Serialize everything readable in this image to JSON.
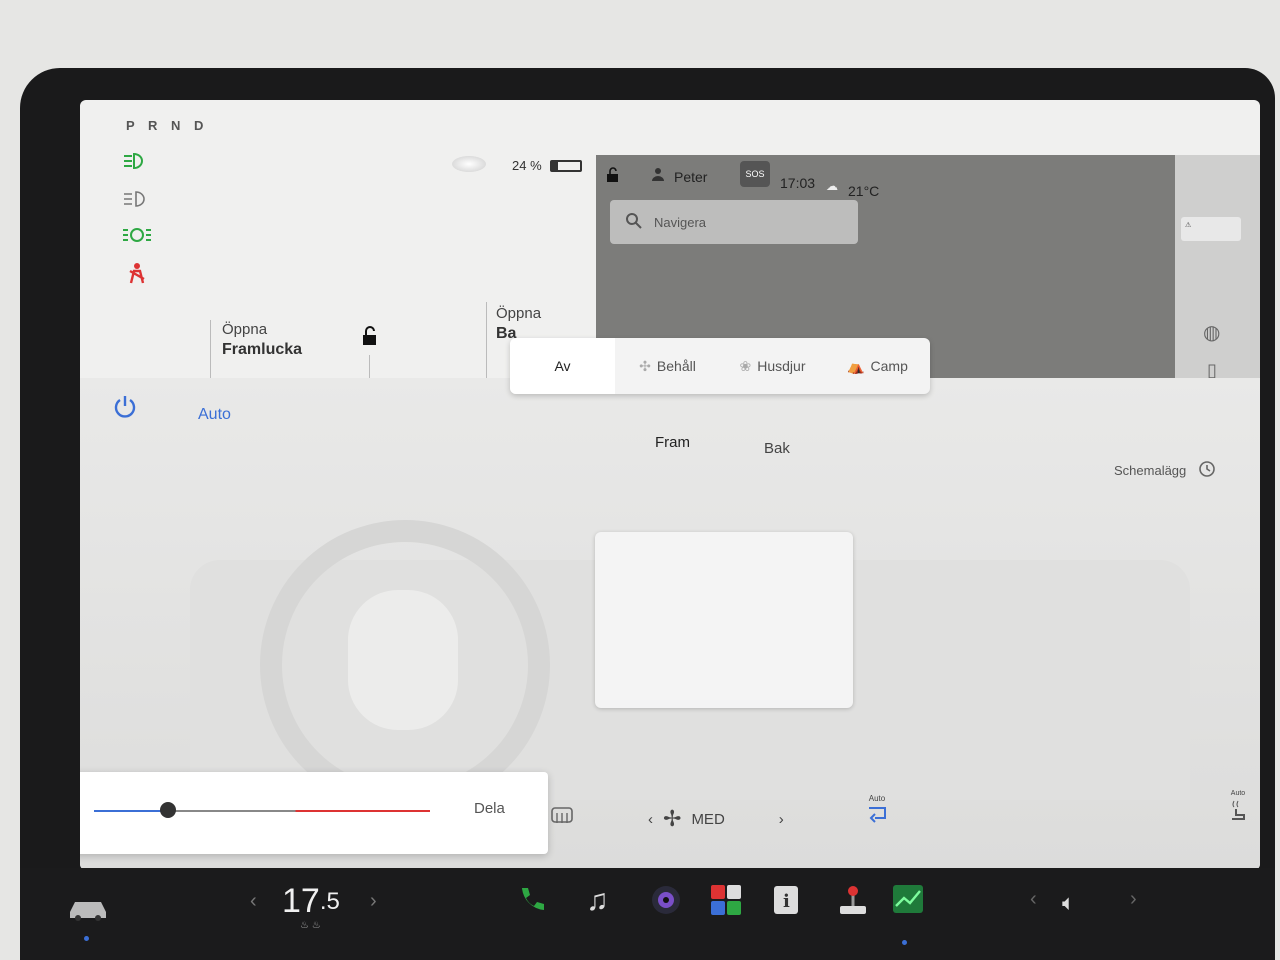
{
  "gear": {
    "label": "P R N D"
  },
  "battery": {
    "percent_text": "24 %",
    "level": 0.24
  },
  "doors": {
    "front": {
      "line1": "Öppna",
      "line2": "Framlucka"
    },
    "rear": {
      "line1": "Öppna",
      "line2": "Ba"
    }
  },
  "statusbar": {
    "user": "Peter",
    "sos": "SOS",
    "time": "17:03",
    "weather": "21°C"
  },
  "nav": {
    "placeholder": "Navigera"
  },
  "climate_mode_tabs": [
    "Av",
    "Behåll",
    "Husdjur",
    "Camp"
  ],
  "climate": {
    "auto_label": "Auto",
    "front_label": "Fram",
    "rear_label": "Bak",
    "schedule_label": "Schemalägg",
    "split_label": "Dela",
    "fan_label": "MED",
    "recirc_label": "Auto",
    "seat_label": "Auto"
  },
  "bottombar": {
    "temp_int": "17",
    "temp_frac": ".5"
  },
  "colors": {
    "accent": "#3b6fd6",
    "heat": "#d33333",
    "lights_green": "#2ea843",
    "seatbelt_red": "#d33333"
  }
}
